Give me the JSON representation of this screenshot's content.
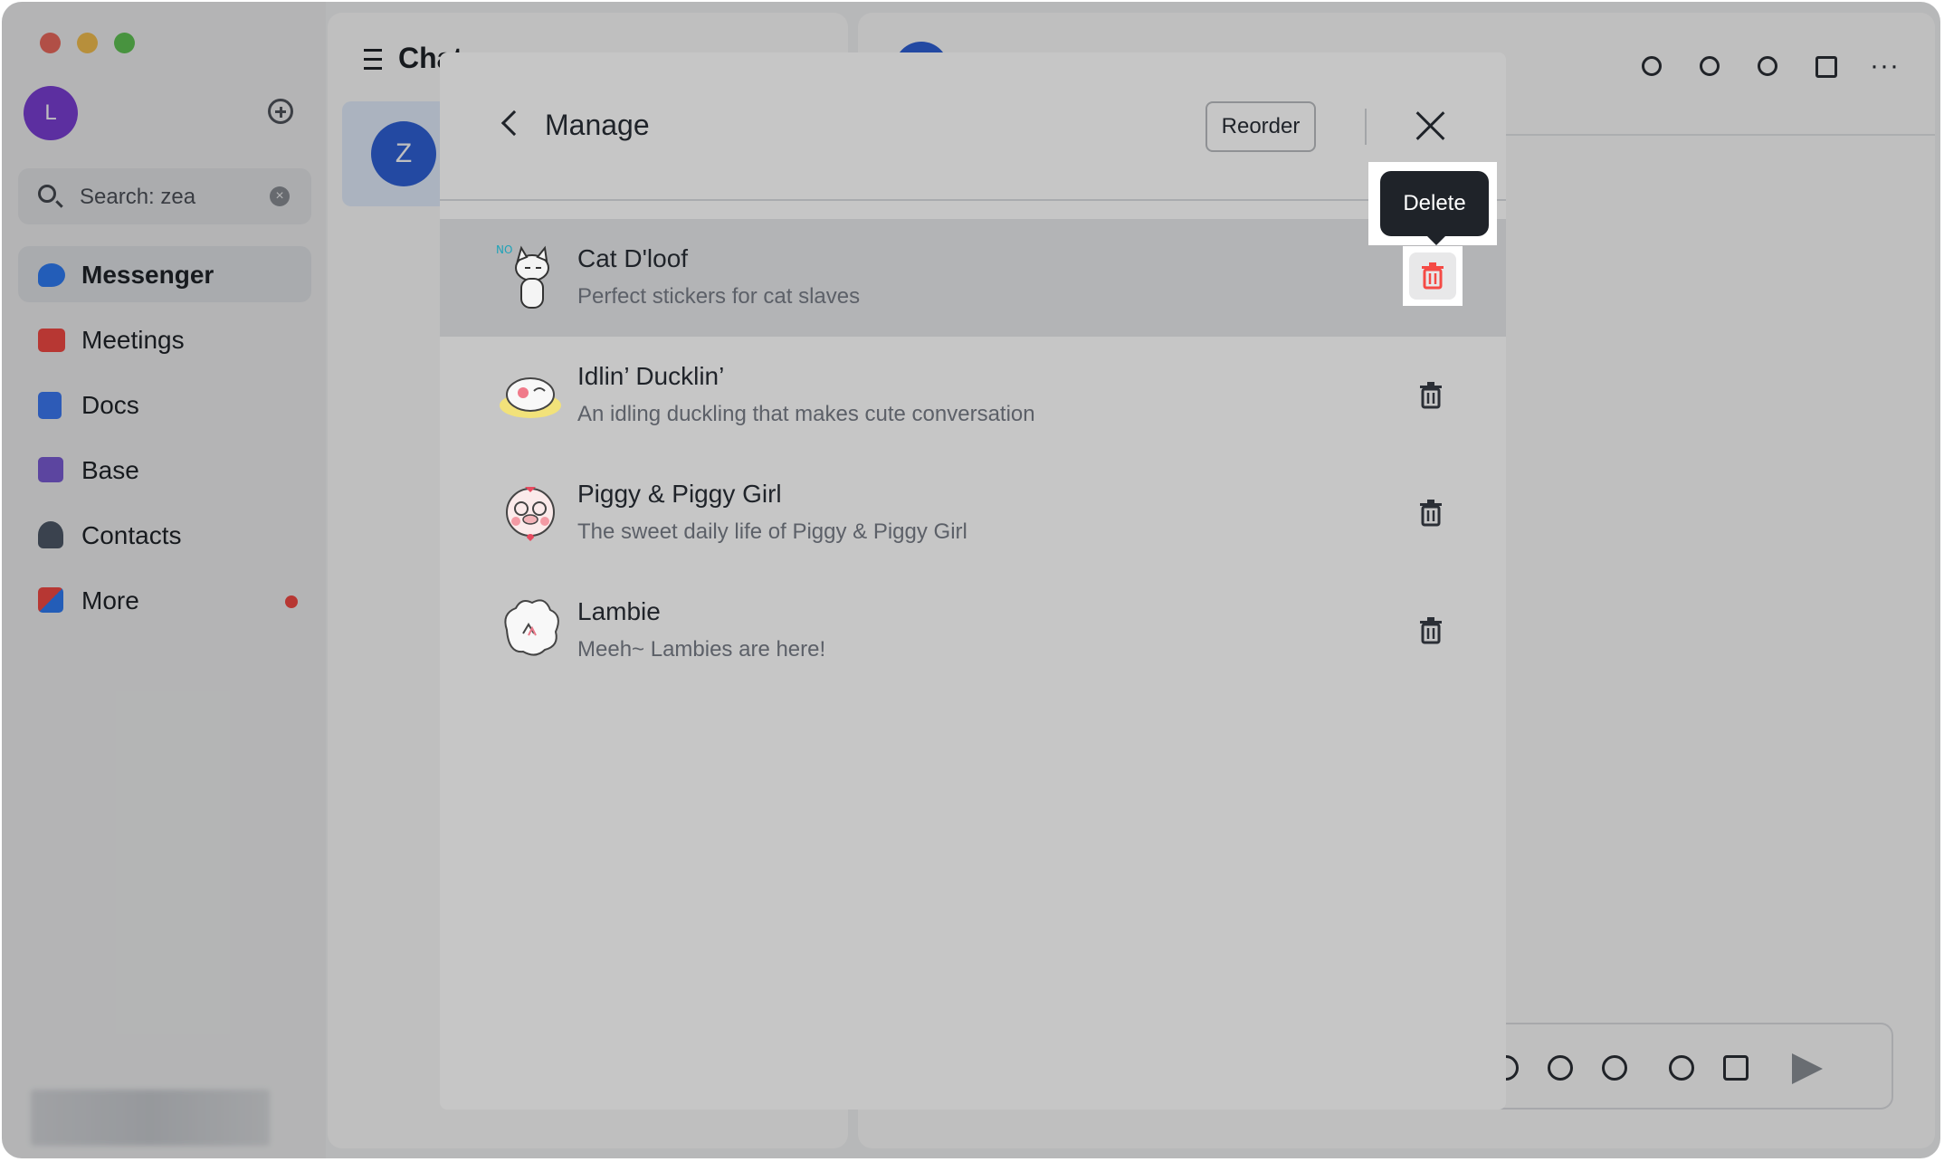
{
  "sidebar": {
    "avatar_letter": "L",
    "search_value": "Search: zea",
    "items": [
      {
        "label": "Messenger",
        "icon": "messenger-icon",
        "color": "#2f7cf6"
      },
      {
        "label": "Meetings",
        "icon": "video-camera-icon",
        "color": "#f54a45"
      },
      {
        "label": "Docs",
        "icon": "docs-icon",
        "color": "#3c7af5"
      },
      {
        "label": "Base",
        "icon": "base-grid-icon",
        "color": "#7b5cd6"
      },
      {
        "label": "Contacts",
        "icon": "contacts-icon",
        "color": "#4e5969"
      },
      {
        "label": "More",
        "icon": "apps-grid-icon",
        "color": "#f5a623"
      }
    ]
  },
  "chatlist": {
    "title": "Chat",
    "conversation_avatar_letter": "Z"
  },
  "modal": {
    "title": "Manage",
    "reorder_label": "Reorder",
    "tooltip": "Delete",
    "stickers": [
      {
        "title": "Cat D'loof",
        "description": "Perfect stickers for cat slaves",
        "thumb": "cat-sticker"
      },
      {
        "title": "Idlin’ Ducklin’",
        "description": "An idling duckling that makes cute conversation",
        "thumb": "duckling-sticker"
      },
      {
        "title": "Piggy & Piggy Girl",
        "description": "The sweet daily life of Piggy & Piggy Girl",
        "thumb": "piggy-sticker"
      },
      {
        "title": "Lambie",
        "description": "Meeh~ Lambies are here!",
        "thumb": "lambie-sticker"
      }
    ]
  },
  "colors": {
    "accent": "#2f62d9",
    "delete_red": "#f54a45",
    "tooltip_bg": "#1f2329"
  }
}
